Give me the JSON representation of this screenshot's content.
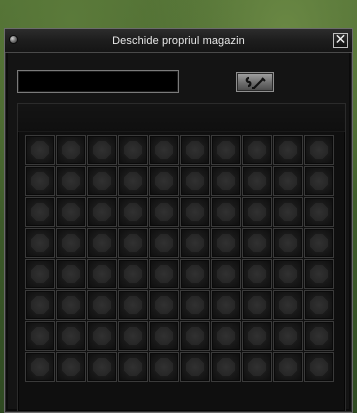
{
  "window": {
    "title": "Deschide propriul magazin",
    "close_icon": "close-icon",
    "close_glyph": "✕"
  },
  "shop_name": {
    "value": "",
    "placeholder": ""
  },
  "sign_button": {
    "icon": "sign-icon"
  },
  "grid": {
    "rows": 8,
    "cols": 10
  }
}
